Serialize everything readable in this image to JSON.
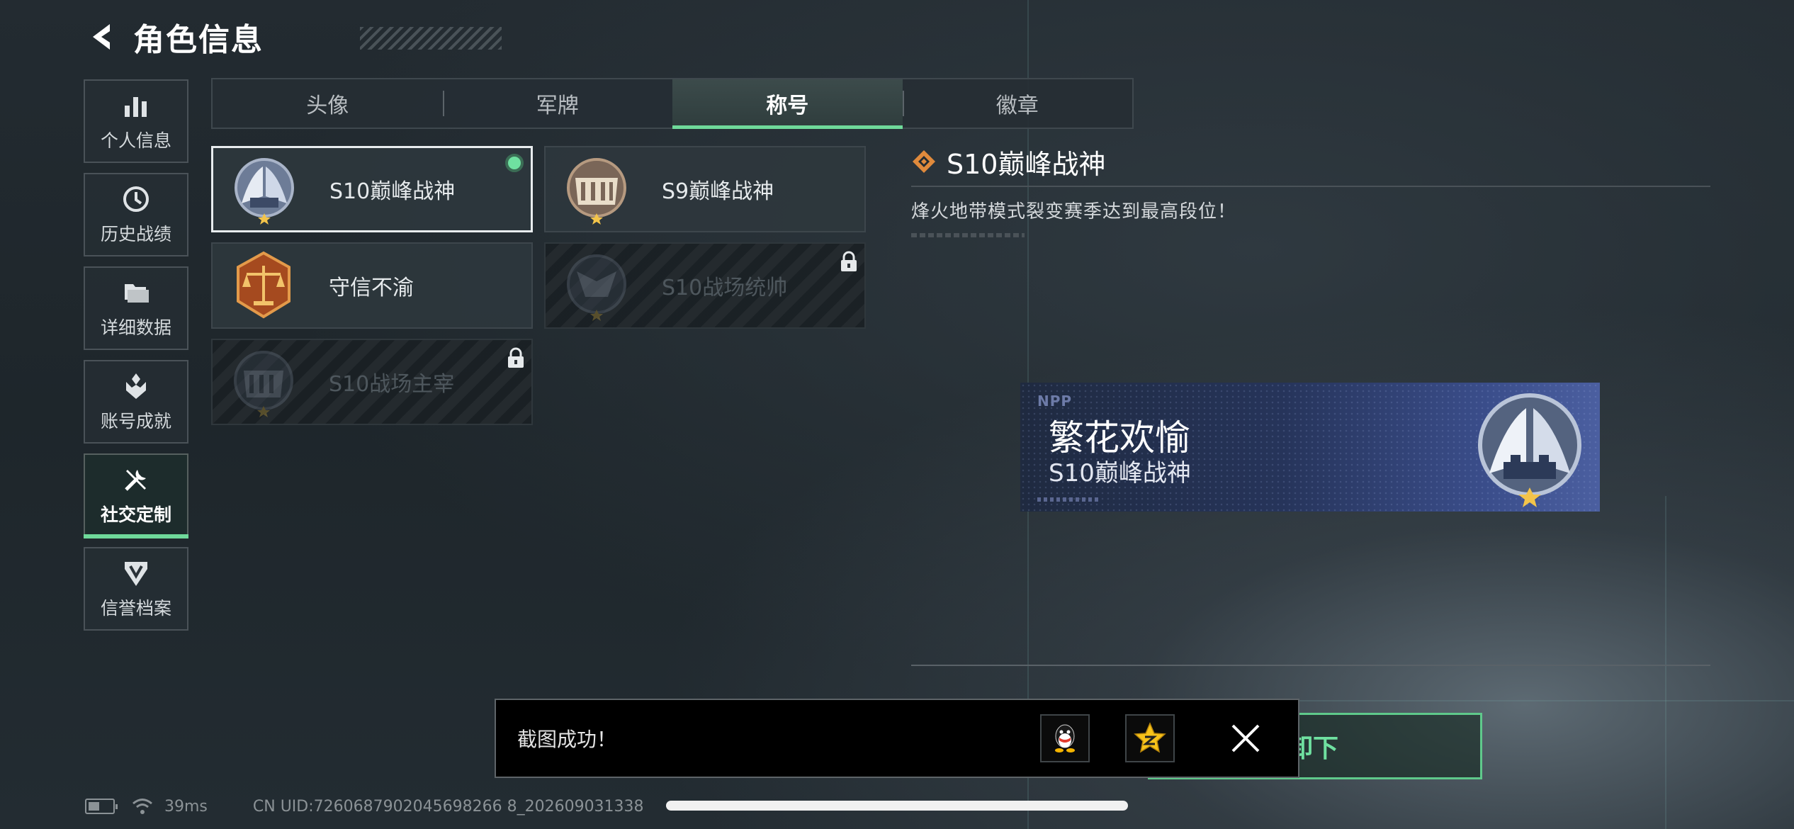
{
  "header": {
    "title": "角色信息",
    "back_icon": "chevron-left-icon"
  },
  "side_menu": {
    "items": [
      {
        "label": "个人信息",
        "icon": "bar-chart-icon",
        "active": false
      },
      {
        "label": "历史战绩",
        "icon": "clock-icon",
        "active": false
      },
      {
        "label": "详细数据",
        "icon": "folder-icon",
        "active": false
      },
      {
        "label": "账号成就",
        "icon": "achievement-icon",
        "active": false
      },
      {
        "label": "社交定制",
        "icon": "tools-icon",
        "active": true
      },
      {
        "label": "信誉档案",
        "icon": "credit-shield-icon",
        "active": false
      }
    ]
  },
  "tabs": [
    {
      "label": "头像",
      "active": false
    },
    {
      "label": "军牌",
      "active": false
    },
    {
      "label": "称号",
      "active": true
    },
    {
      "label": "徽章",
      "active": false
    }
  ],
  "titles": [
    {
      "name": "S10巅峰战神",
      "selected": true,
      "equipped": true,
      "locked": false,
      "emblem": "peak-god-emblem"
    },
    {
      "name": "S9巅峰战神",
      "selected": false,
      "equipped": false,
      "locked": false,
      "emblem": "colosseum-bronze-emblem"
    },
    {
      "name": "守信不渝",
      "selected": false,
      "equipped": false,
      "locked": false,
      "emblem": "scales-emblem"
    },
    {
      "name": "S10战场统帅",
      "selected": false,
      "equipped": false,
      "locked": true,
      "emblem": "commander-emblem"
    },
    {
      "name": "S10战场主宰",
      "selected": false,
      "equipped": false,
      "locked": true,
      "emblem": "colosseum-emblem"
    }
  ],
  "detail": {
    "title": "S10巅峰战神",
    "description": "烽火地带模式裂变赛季达到最高段位！",
    "title_icon": "diamond-icon"
  },
  "nameplate": {
    "logo": "NPP",
    "player_name": "繁花欢愉",
    "title": "S10巅峰战神"
  },
  "bottom_button": {
    "label_visible_fragment": "卸下"
  },
  "toast": {
    "message": "截图成功！",
    "share_qq_icon": "qq-penguin-icon",
    "share_qzone_icon": "qzone-star-icon",
    "close_icon": "close-icon"
  },
  "status_bar": {
    "ping": "39ms",
    "uid": "CN UID:7260687902045698266 8_202609031338"
  },
  "colors": {
    "accent": "#6fd99a",
    "background": "#232b31",
    "nameplate": "#3a4d8a"
  }
}
